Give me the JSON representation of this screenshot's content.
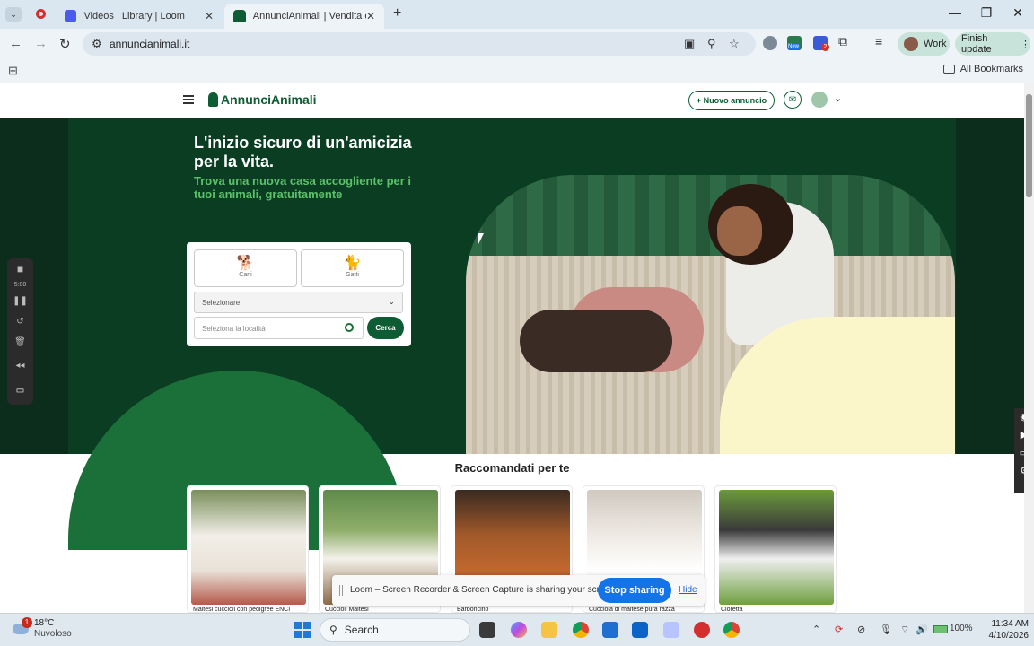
{
  "browser": {
    "tabs": [
      {
        "title": "Videos | Library | Loom",
        "close": "✕"
      },
      {
        "title": "AnnunciAnimali | Vendita e Reg",
        "close": "✕"
      }
    ],
    "new_tab": "+",
    "window_controls": {
      "minimize": "—",
      "maximize": "❐",
      "close": "✕"
    },
    "url": "annuncianimali.it",
    "profile_label": "Work",
    "finish_update_label": "Finish update",
    "all_bookmarks_label": "All Bookmarks",
    "ext_new_badge": "New",
    "ext_count_badge": "2"
  },
  "site": {
    "logo_text": "AnnunciAnimali",
    "new_ad_label": "+ Nuovo annuncio",
    "hero_title": "L'inizio sicuro di un'amicizia per la vita.",
    "hero_subtitle": "Trova una nuova casa accogliente per i tuoi animali, gratuitamente",
    "pets": [
      {
        "label": "Cani",
        "icon": "dog-icon"
      },
      {
        "label": "Gatti",
        "icon": "cat-icon"
      }
    ],
    "select_placeholder": "Selezionare",
    "location_placeholder": "Seleziona la località",
    "search_button": "Cerca",
    "recommended_title": "Raccomandati per te",
    "cards": [
      {
        "caption": "Maltesi cuccioli con pedigree ENCI"
      },
      {
        "caption": "Cuccioli Maltesi"
      },
      {
        "caption": "Barboncino"
      },
      {
        "caption": "Cucciola di maltese pura razza"
      },
      {
        "caption": "Cloretta"
      }
    ]
  },
  "loom": {
    "message": "Loom – Screen Recorder & Screen Capture is sharing your screen.",
    "stop_label": "Stop sharing",
    "hide_label": "Hide",
    "timer": "5:00"
  },
  "taskbar": {
    "temperature": "18°C",
    "weather": "Nuvoloso",
    "weather_badge": "1",
    "search_label": "Search",
    "battery": "100%",
    "time": "11:34 AM",
    "date": "4/10/2026"
  },
  "colors": {
    "brand_green": "#0d5c33",
    "hero_bg": "#0b3d23",
    "accent_green": "#5cc26a",
    "loom_blue": "#1473e6"
  }
}
